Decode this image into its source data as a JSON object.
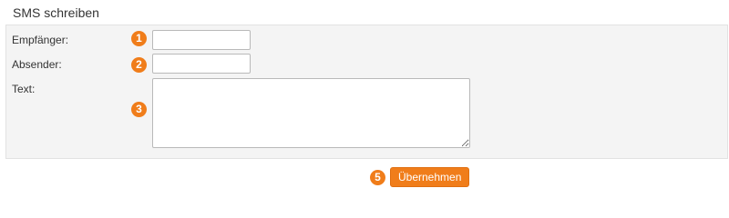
{
  "header": {
    "title": "SMS schreiben"
  },
  "form": {
    "recipient": {
      "label": "Empfänger:",
      "marker": "1",
      "value": ""
    },
    "sender": {
      "label": "Absender:",
      "marker": "2",
      "value": ""
    },
    "text": {
      "label": "Text:",
      "marker": "3",
      "value": ""
    }
  },
  "actions": {
    "submit_marker": "5",
    "submit_label": "Übernehmen"
  },
  "colors": {
    "accent": "#f07d1a",
    "panel_background": "#f4f4f4"
  }
}
